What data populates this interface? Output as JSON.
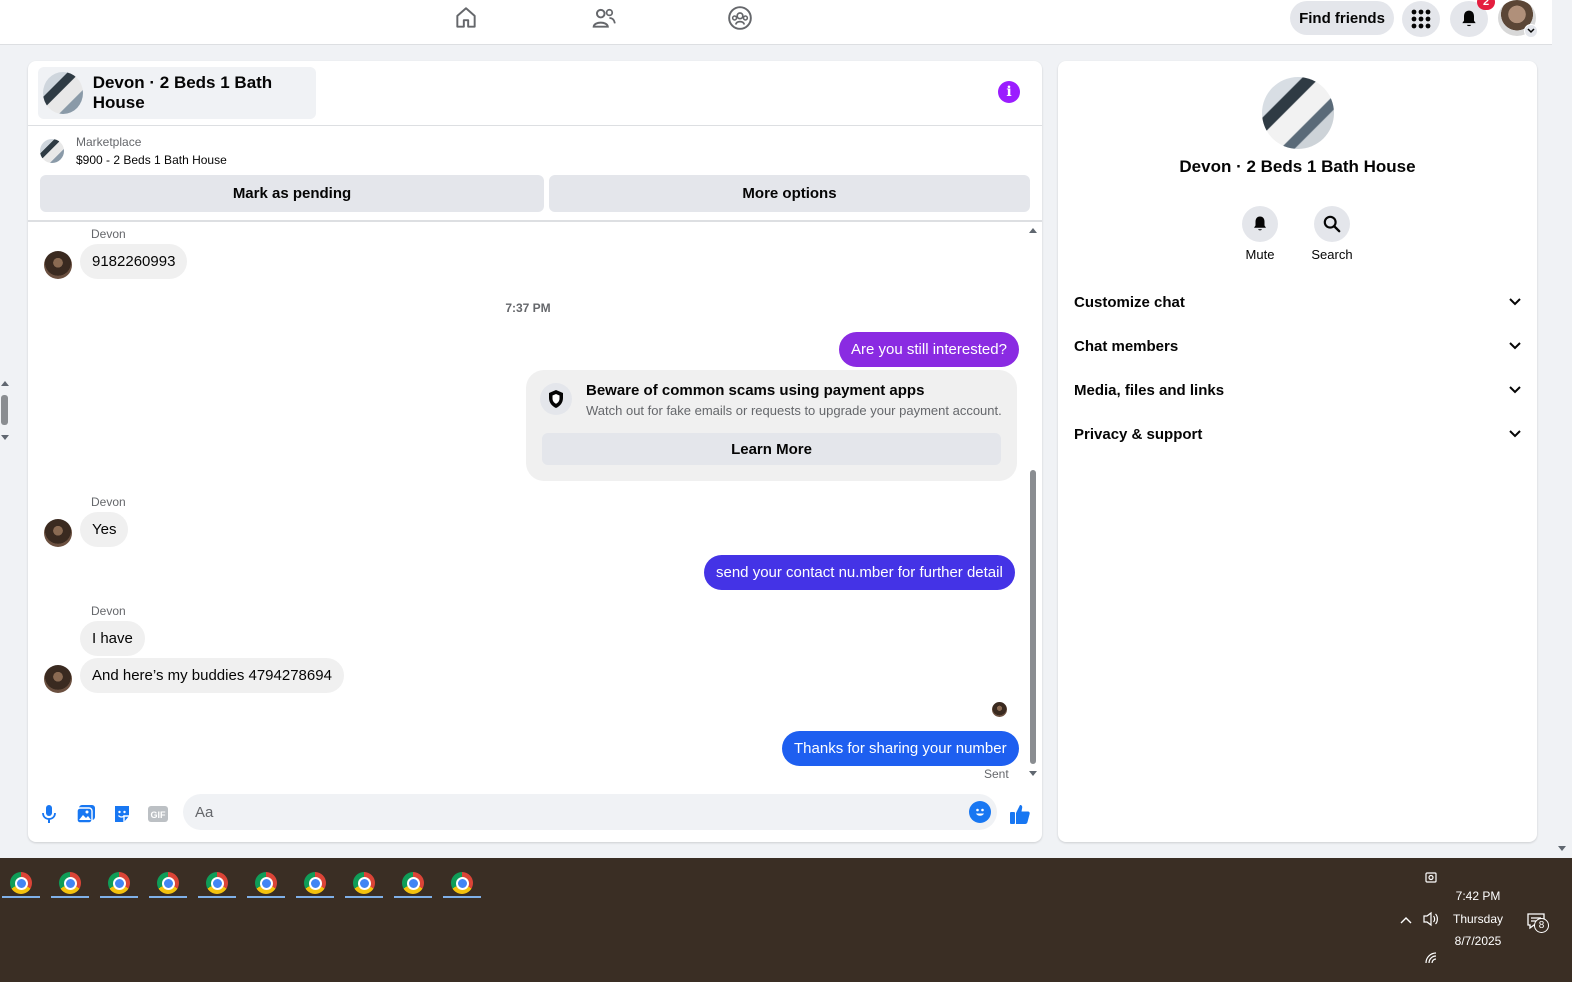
{
  "topbar": {
    "nav": [
      "home-icon",
      "friends-icon",
      "groups-icon"
    ],
    "find_friends_label": "Find friends",
    "notification_count": "2"
  },
  "chat": {
    "title": "Devon · 2 Beds 1 Bath House",
    "marketplace_label": "Marketplace",
    "listing": "$900 - 2 Beds 1 Bath House",
    "mark_pending_label": "Mark as pending",
    "more_options_label": "More options",
    "messages": {
      "sender_1": "Devon",
      "msg_1": "9182260993",
      "time_1": "7:37 PM",
      "out_1": "Are you still interested?",
      "scam_title": "Beware of common scams using payment apps",
      "scam_desc": "Watch out for fake emails or requests to upgrade your payment account.",
      "learn_more": "Learn More",
      "sender_2": "Devon",
      "msg_2": "Yes",
      "out_2": "send your contact nu.mber for further detail",
      "sender_3": "Devon",
      "msg_3": "I have",
      "msg_4": "And here’s my buddies 4794278694",
      "out_3": "Thanks for sharing your number",
      "sent_label": "Sent"
    },
    "composer_placeholder": "Aa"
  },
  "side": {
    "name": "Devon · 2 Beds 1 Bath House",
    "mute_label": "Mute",
    "search_label": "Search",
    "sections": [
      "Customize chat",
      "Chat members",
      "Media, files and links",
      "Privacy & support"
    ]
  },
  "taskbar": {
    "time": "7:42 PM",
    "day": "Thursday",
    "date": "8/7/2025",
    "notification_count": "8"
  },
  "colors": {
    "out_purple": "#8a2be2",
    "out_indigo": "#4433e6",
    "out_blue": "#1e5ff0",
    "messenger_blue": "#1877f2",
    "info_purple": "#9b1dff"
  }
}
